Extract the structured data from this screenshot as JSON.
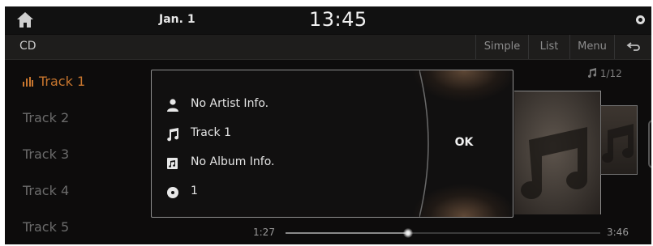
{
  "status_bar": {
    "date": "Jan. 1",
    "time": "13:45",
    "home_icon": "home-icon",
    "status_icon": "record-dot-icon"
  },
  "top_bar": {
    "source": "CD",
    "buttons": {
      "simple": "Simple",
      "list": "List",
      "menu": "Menu",
      "back_icon": "back-arrow-icon"
    }
  },
  "tracks": [
    {
      "label": "Track 1",
      "active": true
    },
    {
      "label": "Track 2",
      "active": false
    },
    {
      "label": "Track 3",
      "active": false
    },
    {
      "label": "Track 4",
      "active": false
    },
    {
      "label": "Track 5",
      "active": false
    }
  ],
  "now_playing": {
    "track_counter": "1/12",
    "elapsed": "1:27",
    "total": "3:46",
    "progress_fraction": 0.39
  },
  "info_popup": {
    "artist": "No Artist Info.",
    "title": "Track 1",
    "album": "No Album Info.",
    "disc": "1",
    "ok_label": "OK"
  },
  "colors": {
    "accent": "#c8762e",
    "background": "#0d0c0c",
    "popup_border": "#8e8e8e"
  }
}
